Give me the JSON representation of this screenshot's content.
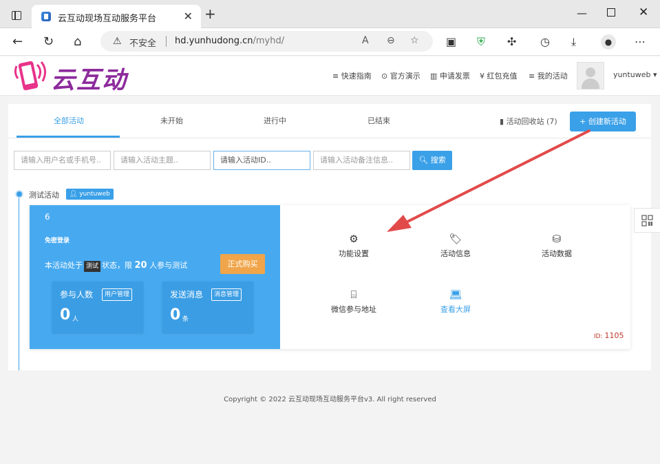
{
  "browser": {
    "tab_title": "云互动现场互动服务平台",
    "close_glyph": "✕",
    "newtab_glyph": "+",
    "insecure_label": "不安全",
    "url_host": "hd.yunhudong.cn",
    "url_path": "/myhd/"
  },
  "header": {
    "logo_text": "云互动",
    "nav": [
      {
        "label": "快速指南",
        "icon": "list-icon"
      },
      {
        "label": "官方演示",
        "icon": "play-icon"
      },
      {
        "label": "申请发票",
        "icon": "barcode-icon"
      },
      {
        "label": "红包充值",
        "icon": "yen-icon"
      },
      {
        "label": "我的活动",
        "icon": "list-icon"
      }
    ],
    "username": "yuntuweb"
  },
  "tabs": {
    "all": "全部活动",
    "not_started": "未开始",
    "ongoing": "进行中",
    "ended": "已结束",
    "recycle": "活动回收站 (7)",
    "create": "+ 创建新活动"
  },
  "search": {
    "user_placeholder": "请输入用户名或手机号..",
    "title_placeholder": "请输入活动主题..",
    "id_placeholder": "请输入活动ID..",
    "note_placeholder": "请输入活动备注信息..",
    "button": "搜索"
  },
  "activity": {
    "group_name": "测试活动",
    "owner": "yuntuweb",
    "number": "6",
    "name": "免密登录",
    "status_prefix": "本活动处于",
    "status_badge": "测试",
    "status_mid": "状态，限",
    "limit": "20",
    "status_suffix": "人参与测试",
    "buy": "正式购买",
    "participants_label": "参与人数",
    "participants_btn": "用户管理",
    "participants_value": "0",
    "participants_unit": "人",
    "messages_label": "发送消息",
    "messages_btn": "消息管理",
    "messages_value": "0",
    "messages_unit": "条",
    "functions": [
      {
        "label": "功能设置",
        "icon": "gear-icon"
      },
      {
        "label": "活动信息",
        "icon": "tag-icon"
      },
      {
        "label": "活动数据",
        "icon": "database-icon"
      },
      {
        "label": "微信参与地址",
        "icon": "scan-icon"
      },
      {
        "label": "查看大屏",
        "icon": "laptop-icon"
      }
    ],
    "id_label": "ID:",
    "id_value": "1105"
  },
  "footer": {
    "copyright": "Copyright © 2022 云互动现场互动服务平台v3. All right reserved"
  },
  "colors": {
    "accent": "#3aa0e8",
    "card_blue": "#47aaf0",
    "buy_orange": "#f0a54a",
    "arrow_red": "#e24a4a"
  }
}
